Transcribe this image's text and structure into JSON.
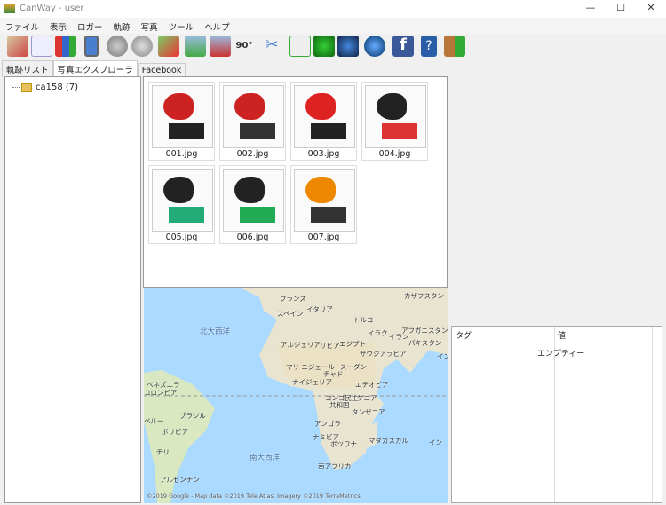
{
  "window": {
    "title": "CanWay - user"
  },
  "menu": [
    "ファイル",
    "表示",
    "ロガー",
    "軌跡",
    "写真",
    "ツール",
    "ヘルプ"
  ],
  "toolbar": [
    "map-pin",
    "track",
    "chart",
    "device",
    "database-upload",
    "database-erase",
    "map-remove",
    "photo-add",
    "photo-remove",
    "rotate-90",
    "tools",
    "csv-export",
    "gpx-export",
    "kml-export",
    "google-earth",
    "facebook",
    "help",
    "exit"
  ],
  "toolbar_rotate_label": "90°",
  "tabs": [
    "軌跡リスト",
    "写真エクスプローラ",
    "Facebook"
  ],
  "tree": {
    "folder": "ca158 (7)"
  },
  "photos": [
    "001.jpg",
    "002.jpg",
    "003.jpg",
    "004.jpg",
    "005.jpg",
    "006.jpg",
    "007.jpg"
  ],
  "map": {
    "labels": [
      "フランス",
      "カザフスタン",
      "スペイン",
      "イタリア",
      "トルコ",
      "アフガニスタン",
      "北大西洋",
      "イラク",
      "イラン",
      "パキスタン",
      "アルジェリア",
      "リビア",
      "エジプト",
      "サウジアラビア",
      "イン",
      "マリ ニジェール",
      "スーダン",
      "チャド",
      "ナイジェリア",
      "エチオピア",
      "ベネズエラ",
      "コロンビア",
      "コンゴ民主",
      "共和国",
      "ケニア",
      "タンザニア",
      "ブラジル",
      "ペルー",
      "アンゴラ",
      "ボリビア",
      "ナミビア",
      "ボツワナ",
      "マダガスカル",
      "イン",
      "チリ",
      "南大西洋",
      "南アフリカ",
      "アルゼンチン"
    ],
    "attribution": "©2019 Google - Map data ©2019 Tele Atlas, Imagery ©2019 TerraMetrics"
  },
  "props": {
    "col_tag": "タグ",
    "col_value": "値",
    "empty": "エンプティー"
  }
}
